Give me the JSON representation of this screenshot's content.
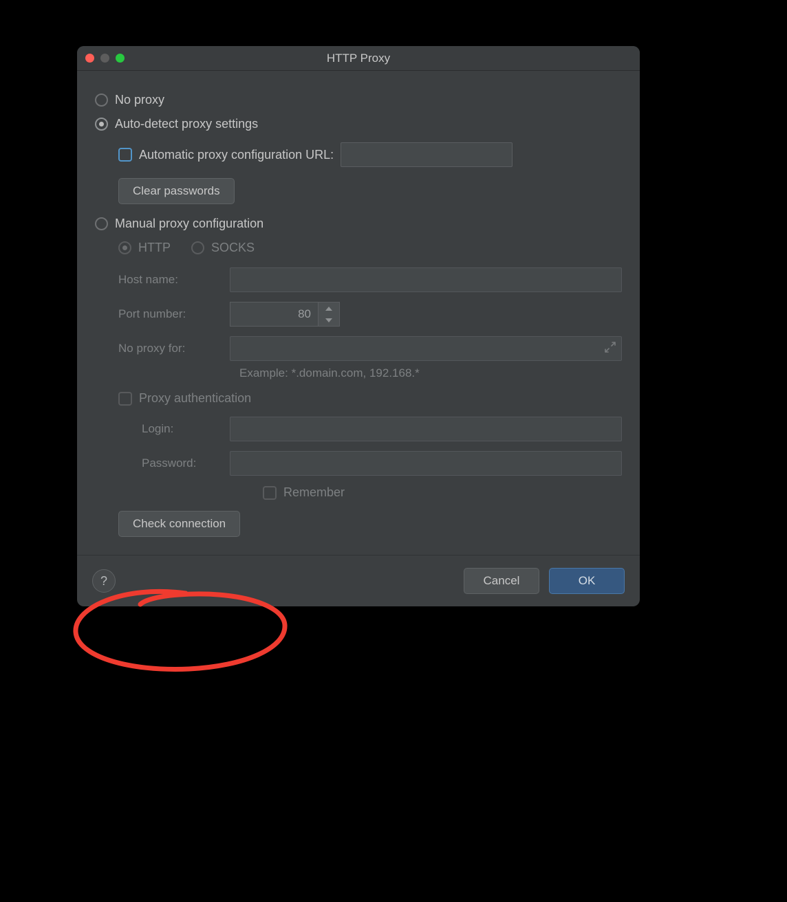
{
  "window": {
    "title": "HTTP Proxy"
  },
  "proxy": {
    "no_proxy_label": "No proxy",
    "auto_detect_label": "Auto-detect proxy settings",
    "auto_url_checkbox_label": "Automatic proxy configuration URL:",
    "clear_passwords_label": "Clear passwords",
    "manual_label": "Manual proxy configuration",
    "http_label": "HTTP",
    "socks_label": "SOCKS",
    "host_name_label": "Host name:",
    "port_number_label": "Port number:",
    "port_number_value": "80",
    "no_proxy_for_label": "No proxy for:",
    "no_proxy_example": "Example: *.domain.com, 192.168.*",
    "proxy_auth_label": "Proxy authentication",
    "login_label": "Login:",
    "password_label": "Password:",
    "remember_label": "Remember",
    "check_connection_label": "Check connection"
  },
  "footer": {
    "help_label": "?",
    "cancel_label": "Cancel",
    "ok_label": "OK"
  },
  "state": {
    "selected_mode": "auto",
    "auto_url_checked": false,
    "manual_protocol": "http",
    "proxy_auth_checked": false,
    "remember_checked": false
  }
}
